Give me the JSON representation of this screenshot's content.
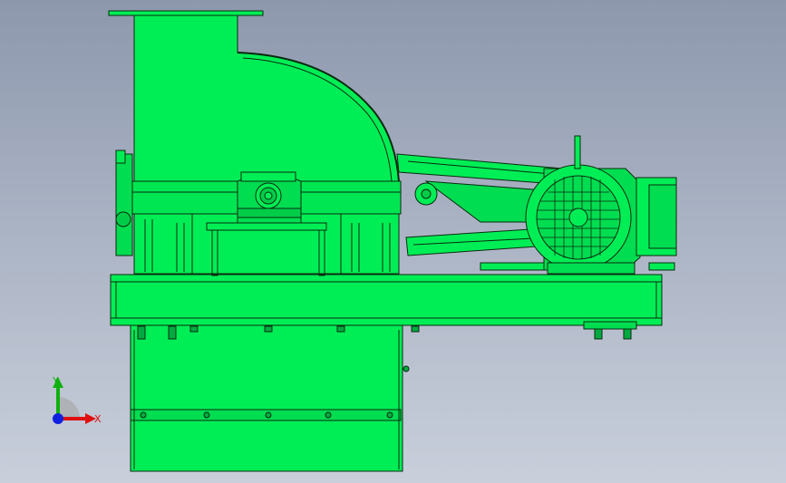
{
  "scene": {
    "model": "hammer-mill-assembly",
    "colors": {
      "background_top": "#8d98ad",
      "background_bottom": "#c9cfdb",
      "part_fill": "#00ee55",
      "part_dark": "#00bb40",
      "edge": "#0a2a10",
      "axis_x": "#e01010",
      "axis_y": "#10b010",
      "axis_z": "#1020e0"
    }
  },
  "triad": {
    "x_label": "X",
    "y_label": "Y"
  }
}
